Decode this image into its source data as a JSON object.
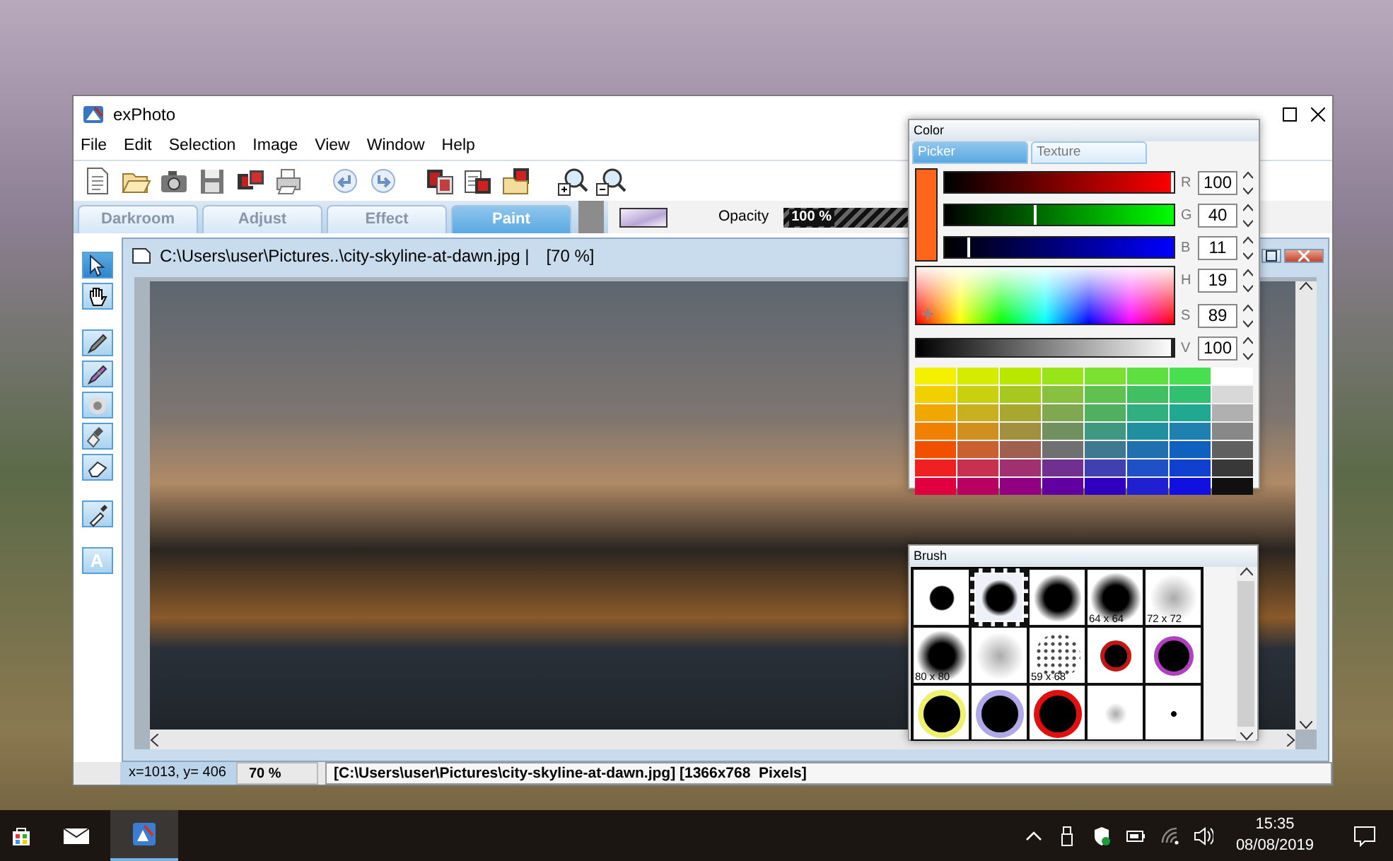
{
  "app_window": {
    "title": "exPhoto",
    "menu": [
      "File",
      "Edit",
      "Selection",
      "Image",
      "View",
      "Window",
      "Help"
    ]
  },
  "tabs": [
    {
      "label": "Darkroom",
      "selected": false
    },
    {
      "label": "Adjust",
      "selected": false
    },
    {
      "label": "Effect",
      "selected": false
    },
    {
      "label": "Paint",
      "selected": true
    }
  ],
  "opacity": {
    "label": "Opacity",
    "reading": "100 %",
    "level": 1
  },
  "tools": [
    {
      "kind": "pointer",
      "selected": true
    },
    {
      "kind": "hand",
      "selected": false
    },
    {
      "kind": "pencil",
      "selected": false
    },
    {
      "kind": "brush",
      "selected": false
    },
    {
      "kind": "airbrush",
      "selected": false
    },
    {
      "kind": "smudge",
      "selected": false
    },
    {
      "kind": "eraser",
      "selected": false
    },
    {
      "kind": "dropper",
      "selected": false
    },
    {
      "kind": "text",
      "label": "A",
      "selected": false
    }
  ],
  "document": {
    "title": "C:\\Users\\user\\Pictures..\\city-skyline-at-dawn.jpg |",
    "zoom": "[70 %]"
  },
  "status_bar": {
    "position": "x=1013, y= 406",
    "zoom": "70 %",
    "info": "[C:\\Users\\user\\Pictures\\city-skyline-at-dawn.jpg] [1366x768  Pixels]"
  },
  "color_panel": {
    "title": "Color",
    "tabs": [
      {
        "label": "Picker",
        "selected": true
      },
      {
        "label": "Texture",
        "selected": false
      }
    ],
    "channels": [
      {
        "kind": "slider",
        "label": "R",
        "value": "100",
        "level": 1,
        "color": "#ff0000"
      },
      {
        "kind": "slider",
        "label": "G",
        "value": "40",
        "level": 0.4,
        "color": "#00ff00"
      },
      {
        "kind": "slider",
        "label": "B",
        "value": "11",
        "level": 0.11,
        "color": "#0000ff"
      },
      {
        "kind": "hue",
        "label": "H",
        "value": "19"
      },
      {
        "kind": "field",
        "label": "S",
        "value": "89"
      },
      {
        "kind": "brightness",
        "label": "V",
        "value": "100",
        "level": 1
      }
    ],
    "palette": [
      {
        "color": "#f5f000"
      },
      {
        "color": "#d5ec00"
      },
      {
        "color": "#b8e800"
      },
      {
        "color": "#9ae41a"
      },
      {
        "color": "#7ce030"
      },
      {
        "color": "#5ee040"
      },
      {
        "color": "#48e050"
      },
      {
        "color": "#ffffff"
      },
      {
        "color": "#f0d000"
      },
      {
        "color": "#c8d010"
      },
      {
        "color": "#a8c820"
      },
      {
        "color": "#88c040"
      },
      {
        "color": "#60c050"
      },
      {
        "color": "#40c060"
      },
      {
        "color": "#30c070"
      },
      {
        "color": "#d8d8d8"
      },
      {
        "color": "#f0a800"
      },
      {
        "color": "#c8b020"
      },
      {
        "color": "#a8a830"
      },
      {
        "color": "#80a850"
      },
      {
        "color": "#50b060"
      },
      {
        "color": "#30b080"
      },
      {
        "color": "#20a890"
      },
      {
        "color": "#b0b0b0"
      },
      {
        "color": "#f08000"
      },
      {
        "color": "#d09020"
      },
      {
        "color": "#a09040"
      },
      {
        "color": "#709060"
      },
      {
        "color": "#409880"
      },
      {
        "color": "#2090a0"
      },
      {
        "color": "#2080b0"
      },
      {
        "color": "#888888"
      },
      {
        "color": "#f05000"
      },
      {
        "color": "#c86030"
      },
      {
        "color": "#a06050"
      },
      {
        "color": "#707070"
      },
      {
        "color": "#407890"
      },
      {
        "color": "#2070b0"
      },
      {
        "color": "#1060c0"
      },
      {
        "color": "#606060"
      },
      {
        "color": "#f02020"
      },
      {
        "color": "#c83050"
      },
      {
        "color": "#a03070"
      },
      {
        "color": "#703090"
      },
      {
        "color": "#4040b0"
      },
      {
        "color": "#2050c8"
      },
      {
        "color": "#1040d0"
      },
      {
        "color": "#383838"
      },
      {
        "color": "#e00040"
      },
      {
        "color": "#b80060"
      },
      {
        "color": "#900080"
      },
      {
        "color": "#6000a0"
      },
      {
        "color": "#3000c0"
      },
      {
        "color": "#2020d0"
      },
      {
        "color": "#1010e0"
      },
      {
        "color": "#101010"
      }
    ]
  },
  "brush_panel": {
    "title": "Brush",
    "brushes": [
      {
        "kind": "hard-small",
        "selected": false
      },
      {
        "kind": "hard",
        "selected": true
      },
      {
        "kind": "soft",
        "selected": false
      },
      {
        "kind": "soft-large",
        "label": "64 x 64",
        "selected": false
      },
      {
        "kind": "haze",
        "label": "72 x 72",
        "selected": false
      },
      {
        "kind": "soft-large",
        "label": "80 x 80",
        "selected": false
      },
      {
        "kind": "haze",
        "selected": false
      },
      {
        "kind": "spray",
        "label": "59 x 68",
        "selected": false
      },
      {
        "kind": "ring-small",
        "color": "#c01818",
        "selected": false
      },
      {
        "kind": "ring",
        "color": "#b040c0",
        "selected": false
      },
      {
        "kind": "ring-large",
        "color": "#f0f070",
        "selected": false
      },
      {
        "kind": "ring-large",
        "color": "#b0a8e8",
        "selected": false
      },
      {
        "kind": "ring-large",
        "color": "#e01010",
        "selected": false
      },
      {
        "kind": "haze-small",
        "selected": false
      },
      {
        "kind": "dot",
        "selected": false
      }
    ]
  },
  "taskbar": {
    "apps": [
      {
        "kind": "mail",
        "selected": false
      },
      {
        "kind": "photo-app",
        "selected": true
      }
    ],
    "time": "15:35",
    "date": "08/08/2019"
  }
}
